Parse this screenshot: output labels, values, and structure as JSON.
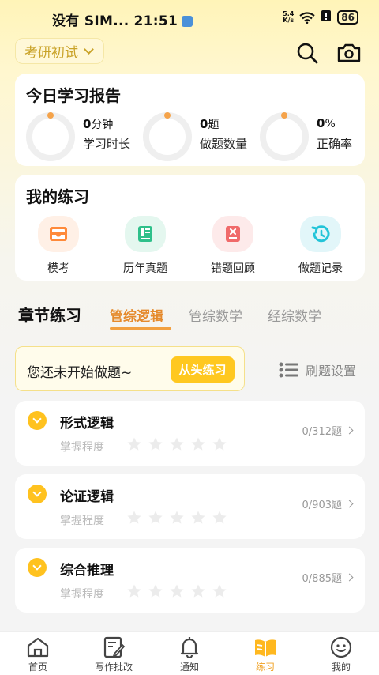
{
  "status_bar": {
    "carrier": "没有 SIM...",
    "time": "21:51",
    "speed_top": "5.4",
    "speed_bottom": "K/s",
    "battery": "86"
  },
  "header": {
    "exam_type": "考研初试"
  },
  "report": {
    "title": "今日学习报告",
    "stats": [
      {
        "value": "0",
        "unit": "分钟",
        "label": "学习时长"
      },
      {
        "value": "0",
        "unit": "题",
        "label": "做题数量"
      },
      {
        "value": "0",
        "unit": "%",
        "label": "正确率"
      }
    ]
  },
  "practice": {
    "title": "我的练习",
    "items": [
      {
        "label": "模考",
        "icon": "exam-tray-icon",
        "color": "#ff8a3a",
        "bg": "#fff0e6"
      },
      {
        "label": "历年真题",
        "icon": "book-icon",
        "color": "#2ec08a",
        "bg": "#e4f7ef"
      },
      {
        "label": "错题回顾",
        "icon": "mistake-doc-icon",
        "color": "#f06a6a",
        "bg": "#fdeaea"
      },
      {
        "label": "做题记录",
        "icon": "history-icon",
        "color": "#23c4d8",
        "bg": "#e2f6f9"
      }
    ]
  },
  "tabs": {
    "heading": "章节练习",
    "items": [
      {
        "label": "管综逻辑",
        "active": true
      },
      {
        "label": "管综数学",
        "active": false
      },
      {
        "label": "经综数学",
        "active": false
      }
    ]
  },
  "start": {
    "message": "您还未开始做题~",
    "button": "从头练习"
  },
  "settings_label": "刷题设置",
  "chapters": [
    {
      "title": "形式逻辑",
      "mastery_label": "掌握程度",
      "stars": 0,
      "count": "0/312题"
    },
    {
      "title": "论证逻辑",
      "mastery_label": "掌握程度",
      "stars": 0,
      "count": "0/903题"
    },
    {
      "title": "综合推理",
      "mastery_label": "掌握程度",
      "stars": 0,
      "count": "0/885题"
    }
  ],
  "bottom_nav": [
    {
      "label": "首页",
      "icon": "home-icon",
      "active": false
    },
    {
      "label": "写作批改",
      "icon": "writing-icon",
      "active": false
    },
    {
      "label": "通知",
      "icon": "bell-icon",
      "active": false
    },
    {
      "label": "练习",
      "icon": "practice-book-icon",
      "active": true
    },
    {
      "label": "我的",
      "icon": "profile-icon",
      "active": false
    }
  ],
  "colors": {
    "accent": "#ffc820",
    "tab_active": "#e58a2c",
    "ring_track": "#efefef",
    "ring_dot": "#f5a34a"
  }
}
